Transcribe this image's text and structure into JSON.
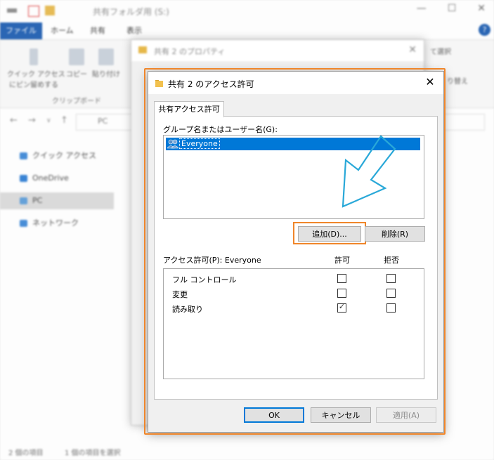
{
  "explorer": {
    "title": "共有フォルダ用 (S:)",
    "window_controls": {
      "minimize": "—",
      "maximize": "☐",
      "close": "✕"
    },
    "tabs": {
      "file": "ファイル",
      "home": "ホーム",
      "share": "共有",
      "view": "表示"
    },
    "ribbon": {
      "pin_label": "クイック アクセス\nにピン留めする",
      "copy_label": "コピー",
      "paste_label": "貼り付け",
      "group_label": "クリップボード",
      "right_top": "て選択",
      "right_bottom": "り替え"
    },
    "address": {
      "path": "PC"
    },
    "nav": {
      "quick_access": "クイック アクセス",
      "onedrive": "OneDrive",
      "pc": "PC",
      "network": "ネットワーク"
    },
    "status": {
      "items": "2 個の項目",
      "selected": "1 個の項目を選択"
    },
    "help": "?"
  },
  "properties": {
    "title": "共有 2 のプロパティ",
    "close": "✕"
  },
  "dialog": {
    "title": "共有 2 のアクセス許可",
    "close": "✕",
    "tab": "共有アクセス許可",
    "group_label": "グループ名またはユーザー名(G):",
    "group_list": [
      {
        "label": "Everyone",
        "selected": true
      }
    ],
    "add_button": "追加(D)...",
    "remove_button": "削除(R)",
    "permissions_label": "アクセス許可(P): Everyone",
    "allow_header": "許可",
    "deny_header": "拒否",
    "permissions": [
      {
        "name": "フル コントロール",
        "allow": false,
        "deny": false
      },
      {
        "name": "変更",
        "allow": false,
        "deny": false
      },
      {
        "name": "読み取り",
        "allow": true,
        "deny": false
      }
    ],
    "ok_button": "OK",
    "cancel_button": "キャンセル",
    "apply_button": "適用(A)"
  },
  "colors": {
    "highlight": "#f0862a",
    "selection": "#0078d7",
    "arrow": "#29a8d8"
  },
  "icons": {
    "folder": "folder-icon",
    "users": "users-icon",
    "close": "close-icon",
    "check": "check-icon",
    "arrow": "pointer-arrow"
  }
}
